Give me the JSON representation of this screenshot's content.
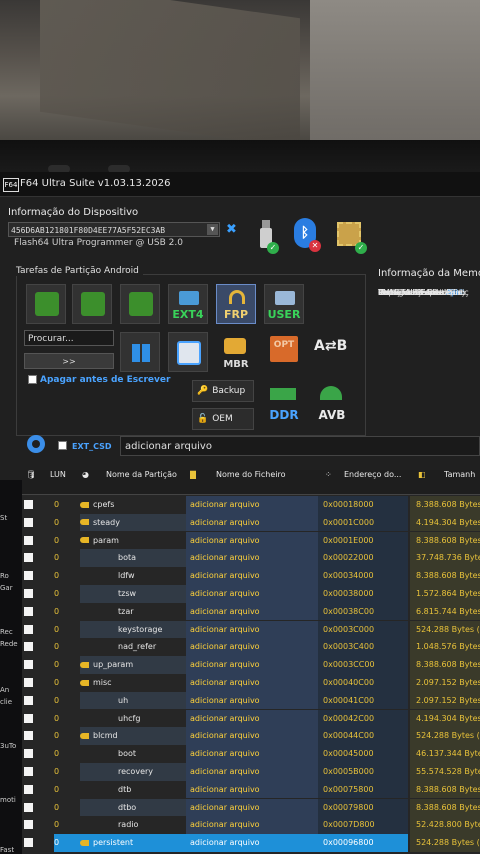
{
  "window": {
    "title": "F64 Ultra Suite v1.03.13.2026",
    "logo": "F64"
  },
  "device": {
    "section_title": "Informação do Dispositivo",
    "serial": "456D6AB121801F80D4EE77A5F52EC3AB",
    "programmer": "Flash64 Ultra Programmer @ USB 2.0"
  },
  "memory_info": {
    "title": "Informação da Memo",
    "rows": [
      {
        "label": "Nome do Produto:",
        "value": "D"
      },
      {
        "label": "ID do Fabricante:",
        "value": "Sa"
      },
      {
        "label": "Capacidade Bruta Tot",
        "value": ""
      },
      {
        "label": "eMMC Active Partition",
        "value": ""
      },
      {
        "label": "Versão da Especificaç",
        "value": ""
      },
      {
        "label": "Data de Fabrico:",
        "value": "April"
      },
      {
        "label": "Partição de Arranque:",
        "value": ""
      },
      {
        "label": "Configuração da Partiç",
        "value": ""
      }
    ]
  },
  "tasks": {
    "title": "Tarefas de Partição Android",
    "tiles": [
      "",
      "",
      "",
      "EXT4",
      "FRP",
      "USER",
      "",
      "",
      "MBR",
      "OPT",
      "",
      "DDR",
      "AVB"
    ],
    "search_placeholder": "Procurar...",
    "go_label": ">>",
    "erase_label": "Apagar antes de Escrever",
    "backup_label": "Backup",
    "oem_label": "OEM"
  },
  "csd": {
    "ext_csd_label": "EXT_CSD",
    "file_field": "adicionar arquivo"
  },
  "table": {
    "headers": {
      "lun": "LUN",
      "name": "Nome da Partição",
      "file": "Nome do Ficheiro",
      "addr": "Endereço do...",
      "size": "Tamanh"
    },
    "rows": [
      {
        "lun": "0",
        "name": "cpefs",
        "key": true,
        "file": "adicionar arquivo",
        "addr": "0x00018000",
        "size": "8.388.608 Bytes"
      },
      {
        "lun": "0",
        "name": "steady",
        "key": true,
        "file": "adicionar arquivo",
        "addr": "0x0001C000",
        "size": "4.194.304 Bytes"
      },
      {
        "lun": "0",
        "name": "param",
        "key": true,
        "file": "adicionar arquivo",
        "addr": "0x0001E000",
        "size": "8.388.608 Bytes"
      },
      {
        "lun": "0",
        "name": "bota",
        "key": false,
        "file": "adicionar arquivo",
        "addr": "0x00022000",
        "size": "37.748.736 Bytes"
      },
      {
        "lun": "0",
        "name": "ldfw",
        "key": false,
        "file": "adicionar arquivo",
        "addr": "0x00034000",
        "size": "8.388.608 Bytes"
      },
      {
        "lun": "0",
        "name": "tzsw",
        "key": false,
        "file": "adicionar arquivo",
        "addr": "0x00038000",
        "size": "1.572.864 Bytes"
      },
      {
        "lun": "0",
        "name": "tzar",
        "key": false,
        "file": "adicionar arquivo",
        "addr": "0x00038C00",
        "size": "6.815.744 Bytes"
      },
      {
        "lun": "0",
        "name": "keystorage",
        "key": false,
        "file": "adicionar arquivo",
        "addr": "0x0003C000",
        "size": "524.288 Bytes (51"
      },
      {
        "lun": "0",
        "name": "nad_refer",
        "key": false,
        "file": "adicionar arquivo",
        "addr": "0x0003C400",
        "size": "1.048.576 Bytes"
      },
      {
        "lun": "0",
        "name": "up_param",
        "key": true,
        "file": "adicionar arquivo",
        "addr": "0x0003CC00",
        "size": "8.388.608 Bytes"
      },
      {
        "lun": "0",
        "name": "misc",
        "key": true,
        "file": "adicionar arquivo",
        "addr": "0x00040C00",
        "size": "2.097.152 Bytes ("
      },
      {
        "lun": "0",
        "name": "uh",
        "key": false,
        "file": "adicionar arquivo",
        "addr": "0x00041C00",
        "size": "2.097.152 Bytes ("
      },
      {
        "lun": "0",
        "name": "uhcfg",
        "key": false,
        "file": "adicionar arquivo",
        "addr": "0x00042C00",
        "size": "4.194.304 Bytes"
      },
      {
        "lun": "0",
        "name": "blcmd",
        "key": true,
        "file": "adicionar arquivo",
        "addr": "0x00044C00",
        "size": "524.288 Bytes (51"
      },
      {
        "lun": "0",
        "name": "boot",
        "key": false,
        "file": "adicionar arquivo",
        "addr": "0x00045000",
        "size": "46.137.344 Bytes"
      },
      {
        "lun": "0",
        "name": "recovery",
        "key": false,
        "file": "adicionar arquivo",
        "addr": "0x0005B000",
        "size": "55.574.528 Bytes"
      },
      {
        "lun": "0",
        "name": "dtb",
        "key": false,
        "file": "adicionar arquivo",
        "addr": "0x00075800",
        "size": "8.388.608 Bytes (8,0"
      },
      {
        "lun": "0",
        "name": "dtbo",
        "key": false,
        "file": "adicionar arquivo",
        "addr": "0x00079800",
        "size": "8.388.608 Bytes (8,0"
      },
      {
        "lun": "0",
        "name": "radio",
        "key": false,
        "file": "adicionar arquivo",
        "addr": "0x0007D800",
        "size": "52.428.800 Bytes ("
      },
      {
        "lun": "0",
        "name": "persistent",
        "key": true,
        "file": "adicionar arquivo",
        "addr": "0x00096800",
        "size": "524.288 Bytes (512"
      }
    ]
  },
  "desktop_left_labels": [
    "St",
    "Ro",
    "Gar",
    "Rec",
    "Rede",
    "An",
    "clie",
    "3uTo",
    "moti",
    "Fast"
  ],
  "colors": {
    "accent": "#1e90d8",
    "link": "#4aa3ff",
    "value": "#e8c23a",
    "file": "#ffd23a"
  }
}
